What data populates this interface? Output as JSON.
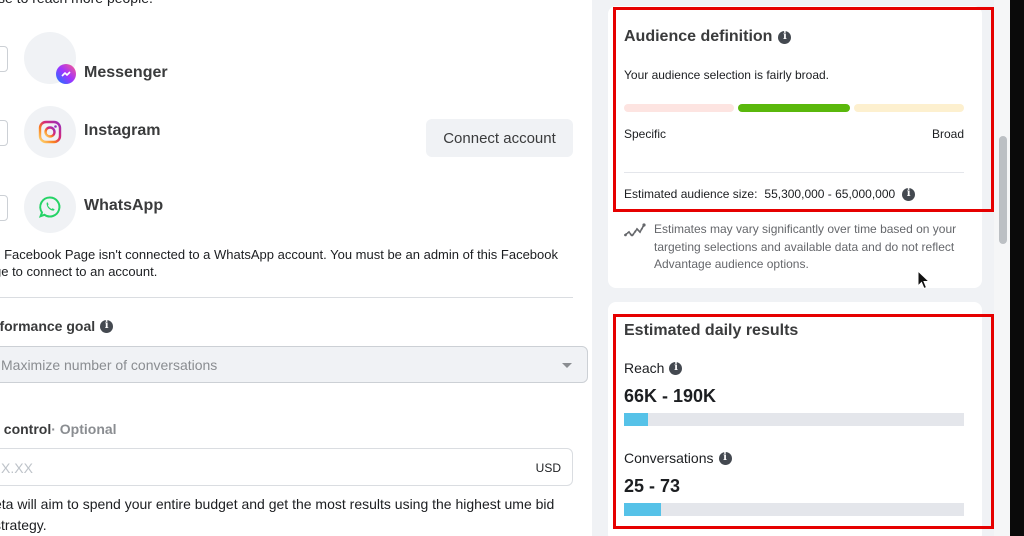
{
  "left_panel": {
    "intro_text": "se to reach more people.",
    "placements": [
      {
        "name": "Messenger",
        "icon": "messenger-icon"
      },
      {
        "name": "Instagram",
        "icon": "instagram-icon",
        "action_label": "Connect account"
      },
      {
        "name": "WhatsApp",
        "icon": "whatsapp-icon"
      }
    ],
    "whatsapp_note": "s Facebook Page isn't connected to a WhatsApp account. You must be an admin of this Facebook ge to connect to an account.",
    "performance_goal": {
      "label": "rformance goal",
      "selected": "Maximize number of conversations"
    },
    "bid_control": {
      "label": "l control",
      "optional": " · Optional",
      "placeholder": "X.XX",
      "currency": "USD",
      "help_text": "eta will aim to spend your entire budget and get the most results using the highest ume bid strategy."
    }
  },
  "audience_card": {
    "title": "Audience definition",
    "status_text": "Your audience selection is fairly broad.",
    "scale_left": "Specific",
    "scale_right": "Broad",
    "active_segment": 2,
    "segment_count": 3,
    "colors": {
      "specific": "#fde4e1",
      "active": "#5ab80c",
      "broad": "#fdf0cf"
    },
    "size_label": "Estimated audience size:",
    "size_value": "55,300,000 - 65,000,000",
    "note": "Estimates may vary significantly over time based on your targeting selections and available data and do not reflect Advantage audience options."
  },
  "daily_results_card": {
    "title": "Estimated daily results",
    "metrics": [
      {
        "label": "Reach",
        "value": "66K - 190K",
        "bar_fraction": 0.07
      },
      {
        "label": "Conversations",
        "value": "25 - 73",
        "bar_fraction": 0.11
      }
    ],
    "bar_color": "#56c2e8"
  },
  "highlight_color": "#e60000"
}
